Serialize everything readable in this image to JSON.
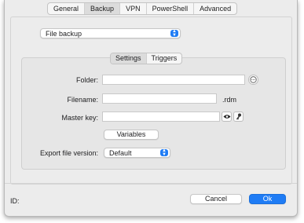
{
  "tabs": [
    "General",
    "Backup",
    "VPN",
    "PowerShell",
    "Advanced"
  ],
  "active_tab": "Backup",
  "backup_type": {
    "value": "File backup"
  },
  "sub_tabs": [
    "Settings",
    "Triggers"
  ],
  "active_sub_tab": "Settings",
  "form": {
    "folder_label": "Folder:",
    "folder_value": "",
    "filename_label": "Filename:",
    "filename_value": "",
    "filename_suffix": ".rdm",
    "master_key_label": "Master key:",
    "master_key_value": "",
    "variables_button": "Variables",
    "export_version_label": "Export file version:",
    "export_version_value": "Default"
  },
  "footer": {
    "id_label": "ID:",
    "cancel_label": "Cancel",
    "ok_label": "Ok"
  },
  "colors": {
    "accent": "#1f7cf5",
    "window_bg": "#ececec"
  },
  "icons": [
    "ellipsis-icon",
    "eye-icon",
    "key-icon",
    "chevron-updown-icon"
  ]
}
